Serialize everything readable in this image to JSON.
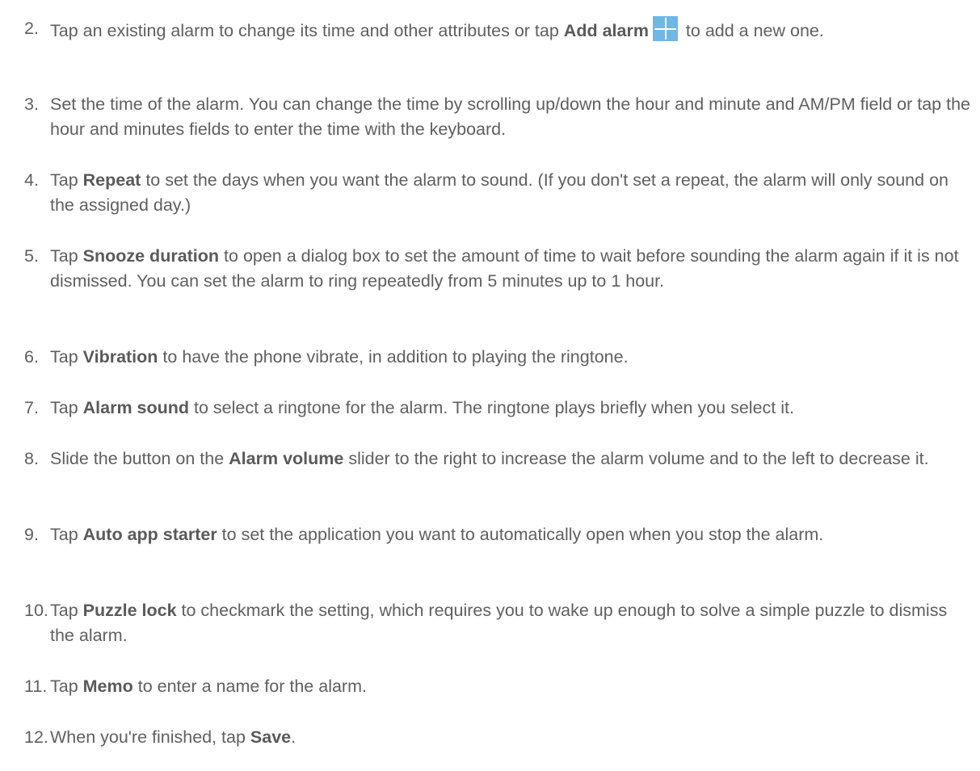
{
  "steps": [
    {
      "num": "2.",
      "p1": "Tap an existing alarm to change its time and other attributes or tap ",
      "b1": "Add alarm",
      "icon": "add-plus-icon",
      "p2": " to add a new one."
    },
    {
      "num": "3.",
      "p1": "Set the time of the alarm. You can change the time by scrolling up/down the hour and minute and AM/PM field or tap the hour and minutes fields to enter the time with the keyboard."
    },
    {
      "num": "4.",
      "p1": "Tap ",
      "b1": "Repeat",
      "p2": " to set the days when you want the alarm to sound. (If you don't set a repeat, the alarm will only sound on the assigned day.)"
    },
    {
      "num": "5.",
      "p1": "Tap ",
      "b1": "Snooze duration",
      "p2": " to open a dialog box to set the amount of time to wait before sounding the alarm again if it is not dismissed. You can set the alarm to ring repeatedly from 5 minutes up to 1 hour."
    },
    {
      "num": "6.",
      "p1": "Tap ",
      "b1": "Vibration",
      "p2": " to have the phone vibrate, in addition to playing the ringtone."
    },
    {
      "num": "7.",
      "p1": "Tap ",
      "b1": "Alarm sound",
      "p2": " to select a ringtone for the alarm. The ringtone plays briefly when you select it."
    },
    {
      "num": "8.",
      "p1": "Slide the button on the ",
      "b1": "Alarm volume",
      "p2": " slider to the right to increase the alarm volume and to the left to decrease it."
    },
    {
      "num": "9.",
      "p1": "Tap ",
      "b1": "Auto app starter",
      "p2": " to set the application you want to automatically open when you stop the alarm."
    },
    {
      "num": "10.",
      "p1": "Tap ",
      "b1": "Puzzle lock",
      "p2": " to checkmark the setting, which requires you to wake up enough to solve a simple puzzle to dismiss the alarm."
    },
    {
      "num": "11.",
      "p1": "Tap ",
      "b1": "Memo",
      "p2": " to enter a name for the alarm."
    },
    {
      "num": "12.",
      "p1": "When you're finished, tap ",
      "b1": "Save",
      "p2": "."
    }
  ]
}
